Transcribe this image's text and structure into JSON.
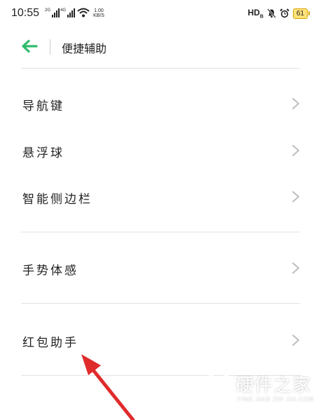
{
  "status_bar": {
    "time": "10:55",
    "signal1_tag": "2G",
    "signal2_tag": "4G",
    "net_speed_value": "1.00",
    "net_speed_unit": "KB/S",
    "hd_label": "HD",
    "hd_sub": "B",
    "battery_level": "61",
    "icons": [
      "signal-icon",
      "signal-icon",
      "wifi-icon",
      "mute-icon",
      "alarm-icon",
      "battery-icon"
    ],
    "battery_color": "#ffe27a"
  },
  "header": {
    "title": "便捷辅助",
    "back_icon": "back-arrow-icon",
    "accent_color": "#2dbb6b"
  },
  "menu": {
    "items": [
      {
        "label": "导航键"
      },
      {
        "label": "悬浮球"
      },
      {
        "label": "智能侧边栏"
      },
      {
        "label": "手势体感"
      },
      {
        "label": "红包助手"
      }
    ]
  },
  "annotation": {
    "arrow_color": "#e02b2b"
  },
  "watermark": {
    "title": "硬件之家",
    "subtitle": "YING JIAN ZHI JIA.COM"
  }
}
